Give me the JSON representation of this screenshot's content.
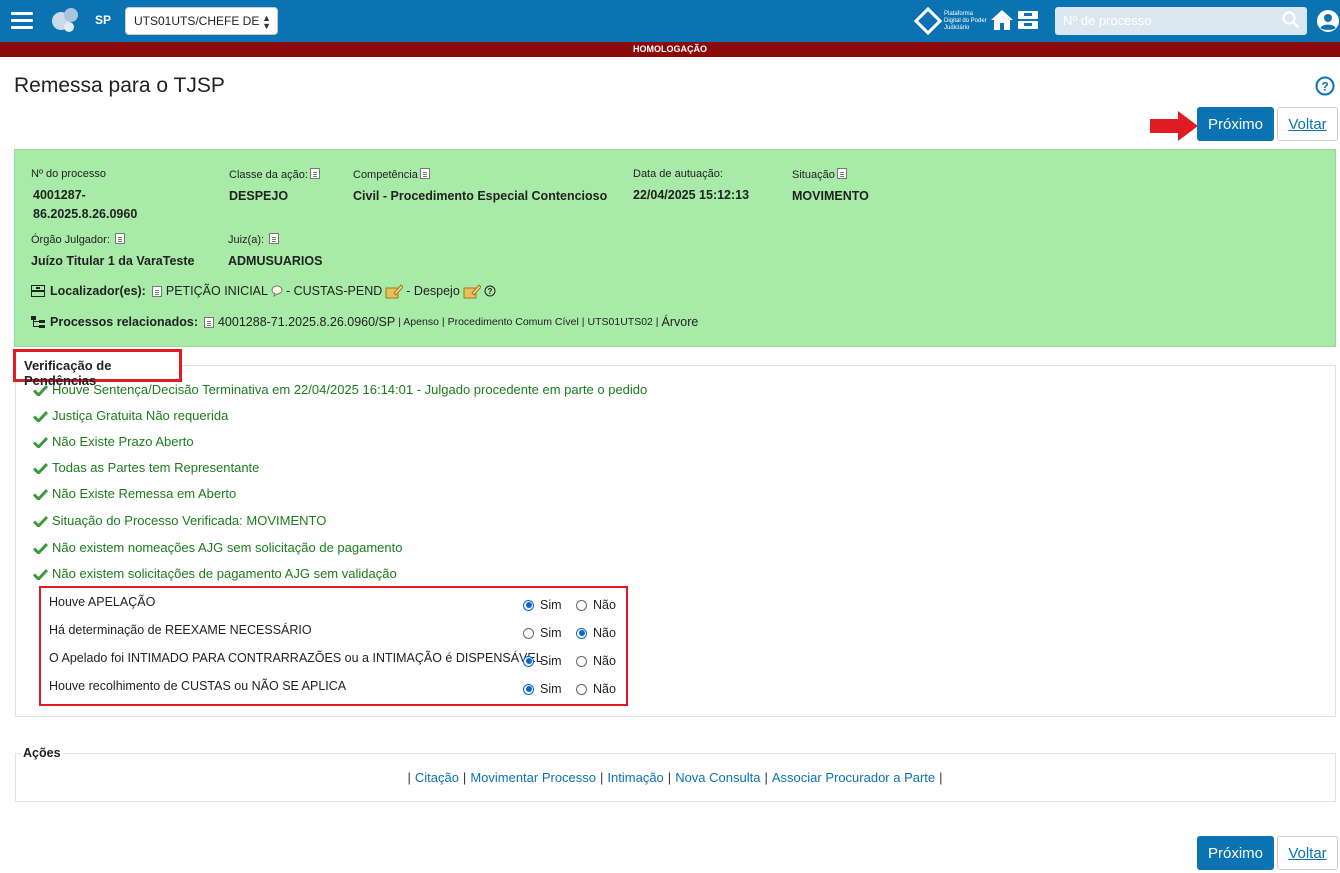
{
  "topbar": {
    "state": "SP",
    "profile_select": "UTS01UTS/CHEFE DE",
    "platform_logo_text": "Plataforma Digital do Poder Judiciário",
    "search_placeholder": "Nº de processo"
  },
  "env_banner": "HOMOLOGAÇÃO",
  "page": {
    "title": "Remessa para o TJSP"
  },
  "buttons": {
    "next": "Próximo",
    "back": "Voltar"
  },
  "process": {
    "numero_label": "Nº do processo",
    "numero_value_1": "4001287-",
    "numero_value_2": "86.2025.8.26.0960",
    "classe_label": "Classe da ação:",
    "classe_value": "DESPEJO",
    "competencia_label": "Competência",
    "competencia_value": "Civil - Procedimento Especial Contencioso",
    "data_label": "Data de autuação:",
    "data_value": "22/04/2025 15:12:13",
    "situacao_label": "Situação",
    "situacao_value": "MOVIMENTO",
    "orgao_label": "Órgão Julgador:",
    "orgao_value": "Juízo Titular 1 da VaraTeste",
    "juiz_label": "Juiz(a):",
    "juiz_value": "ADMUSUARIOS",
    "localizador_label": "Localizador(es):",
    "loc_1": "PETIÇÃO INICIAL",
    "loc_2": "- CUSTAS-PEND",
    "loc_3": "- Despejo",
    "relacionados_label": "Processos relacionados:",
    "rel_numero": "4001288-71.2025.8.26.0960/SP",
    "rel_tipo": "| Apenso |",
    "rel_classe": "Procedimento Comum Cível |",
    "rel_local": "UTS01UTS02 |",
    "rel_arvore": "Árvore"
  },
  "pendencias": {
    "title": "Verificação de Pendências",
    "items": [
      "Houve Sentença/Decisão Terminativa em 22/04/2025 16:14:01 - Julgado procedente em parte o pedido",
      "Justiça Gratuita Não requerida",
      "Não Existe Prazo Aberto",
      "Todas as Partes tem Representante",
      "Não Existe Remessa em Aberto",
      "Situação do Processo Verificada: MOVIMENTO",
      "Não existem nomeações AJG sem solicitação de pagamento",
      "Não existem solicitações de pagamento AJG sem validação"
    ],
    "questions": [
      {
        "text": "Houve APELAÇÃO",
        "answer": "Sim"
      },
      {
        "text": "Há determinação de REEXAME NECESSÁRIO",
        "answer": "Não"
      },
      {
        "text": "O Apelado foi INTIMADO PARA CONTRARRAZÕES ou a INTIMAÇÃO é DISPENSÁVEL",
        "answer": "Sim"
      },
      {
        "text": "Houve recolhimento de CUSTAS ou NÃO SE APLICA",
        "answer": "Sim"
      }
    ],
    "yes_label": "Sim",
    "no_label": "Não"
  },
  "acoes": {
    "title": "Ações",
    "links": [
      "Citação",
      "Movimentar Processo",
      "Intimação",
      "Nova Consulta",
      "Associar Procurador a Parte"
    ]
  },
  "colors": {
    "primary": "#0b73b2",
    "env_banner": "#8b0a0a",
    "info_panel": "#a8eba8",
    "highlight": "#e01b24",
    "check": "#1c7c1c"
  }
}
